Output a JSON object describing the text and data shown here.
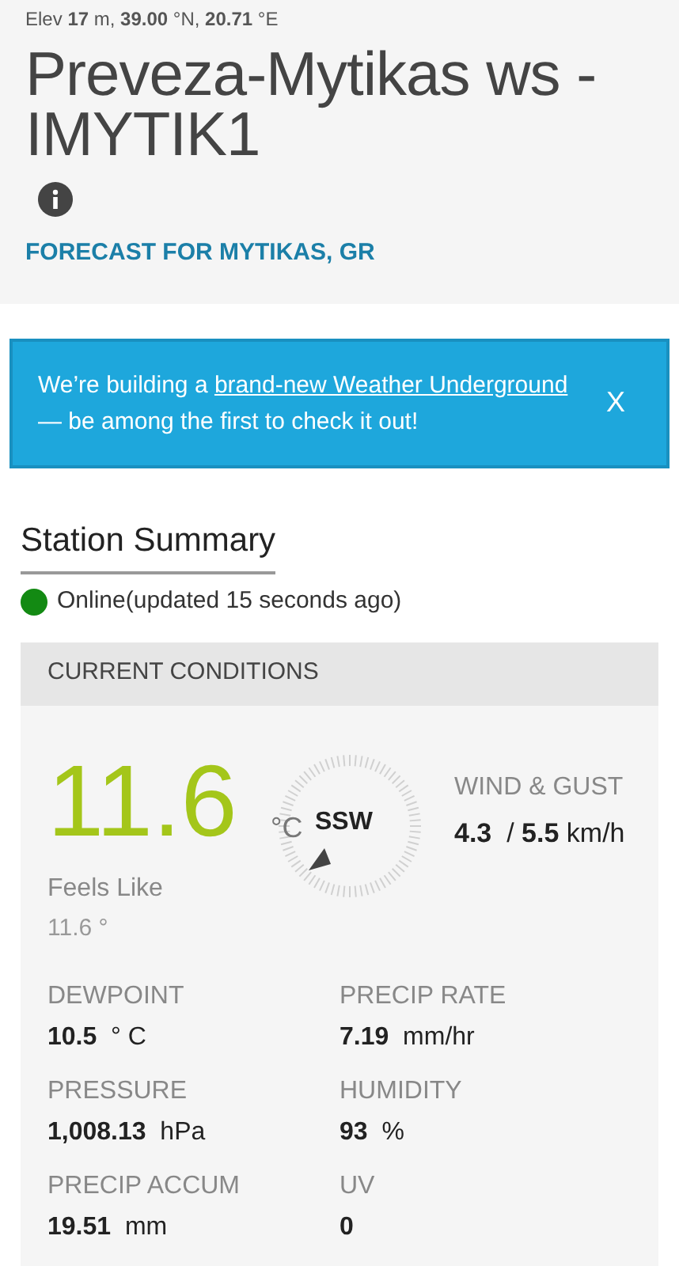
{
  "header": {
    "location_line": "Elev **17** m, **39.00** °N, **20.71** °E",
    "title": "Preveza-Mytikas ws - IMYTIK1",
    "forecast_link": "FORECAST FOR MYTIKAS, GR"
  },
  "banner": {
    "text_before": "We’re building a",
    "link": "brand-new Weather Underground",
    "text_after": "— be among the first to check it out!",
    "close": "X"
  },
  "summary": {
    "title": "Station Summary",
    "status": {
      "text": "Online(updated 15 seconds ago)",
      "color": "#138a13"
    }
  },
  "current": {
    "heading": "CURRENT CONDITIONS",
    "temperature": "11.6",
    "unit": "°C",
    "direction": "SSW",
    "feels_like_label": "Feels Like",
    "feels_like": "11.6 °",
    "wind_label": "WIND & GUST",
    "wind": "**4.3**  / **5.5** km/h",
    "metrics": [
      {
        "label": "DEWPOINT",
        "reading": "**10.5**  ° C"
      },
      {
        "label": "PRECIP RATE",
        "reading": "**7.19**  mm/hr"
      },
      {
        "label": "PRESSURE",
        "reading": "**1,008.13**  hPa"
      },
      {
        "label": "HUMIDITY",
        "reading": "**93**  %"
      },
      {
        "label": "PRECIP ACCUM",
        "reading": "**19.51**  mm"
      },
      {
        "label": "UV",
        "reading": "**0**"
      }
    ]
  }
}
